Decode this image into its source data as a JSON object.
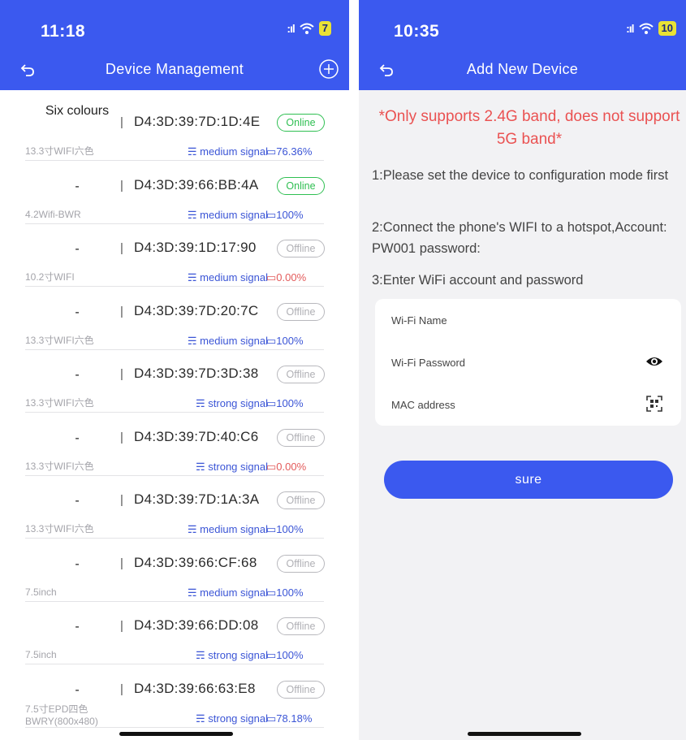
{
  "left": {
    "status": {
      "time": "11:18",
      "battery": "7"
    },
    "title": "Device Management",
    "devices": [
      {
        "name": "Six colours",
        "mac": "D4:3D:39:7D:1D:4E",
        "status": "Online",
        "model": "13.3寸WIFI六色",
        "signal": "medium signal",
        "battery": "76.36%"
      },
      {
        "name": "-",
        "mac": "D4:3D:39:66:BB:4A",
        "status": "Online",
        "model": "4.2Wifi-BWR",
        "signal": "medium signal",
        "battery": "100%"
      },
      {
        "name": "-",
        "mac": "D4:3D:39:1D:17:90",
        "status": "Offline",
        "model": "10.2寸WIFI",
        "signal": "medium signal",
        "battery": "0.00%"
      },
      {
        "name": "-",
        "mac": "D4:3D:39:7D:20:7C",
        "status": "Offline",
        "model": "13.3寸WIFI六色",
        "signal": "medium signal",
        "battery": "100%"
      },
      {
        "name": "-",
        "mac": "D4:3D:39:7D:3D:38",
        "status": "Offline",
        "model": "13.3寸WIFI六色",
        "signal": "strong signal",
        "battery": "100%"
      },
      {
        "name": "-",
        "mac": "D4:3D:39:7D:40:C6",
        "status": "Offline",
        "model": "13.3寸WIFI六色",
        "signal": "strong signal",
        "battery": "0.00%"
      },
      {
        "name": "-",
        "mac": "D4:3D:39:7D:1A:3A",
        "status": "Offline",
        "model": "13.3寸WIFI六色",
        "signal": "medium signal",
        "battery": "100%"
      },
      {
        "name": "-",
        "mac": "D4:3D:39:66:CF:68",
        "status": "Offline",
        "model": "7.5inch",
        "signal": "medium signal",
        "battery": "100%"
      },
      {
        "name": "-",
        "mac": "D4:3D:39:66:DD:08",
        "status": "Offline",
        "model": "7.5inch",
        "signal": "strong signal",
        "battery": "100%"
      },
      {
        "name": "-",
        "mac": "D4:3D:39:66:63:E8",
        "status": "Offline",
        "model": "7.5寸EPD四色 BWRY(800x480)",
        "signal": "strong signal",
        "battery": "78.18%"
      }
    ]
  },
  "right": {
    "status": {
      "time": "10:35",
      "battery": "10"
    },
    "title": "Add New Device",
    "notice": "*Only supports 2.4G band, does not support 5G band*",
    "steps": [
      "1:Please set the device to configuration mode first",
      "2:Connect the phone's WIFI to a hotspot,Account: PW001 password:",
      "3:Enter WiFi account and password"
    ],
    "fields": {
      "wifi_name": "Wi-Fi Name",
      "wifi_password": "Wi-Fi Password",
      "mac_address": "MAC address"
    },
    "sure_label": "sure"
  },
  "colors": {
    "primary": "#3b59ef",
    "online": "#2fbf52",
    "offline": "#b0b0b5",
    "signal": "#3b55d6",
    "low_battery": "#e35b5b",
    "notice": "#ea5252"
  }
}
